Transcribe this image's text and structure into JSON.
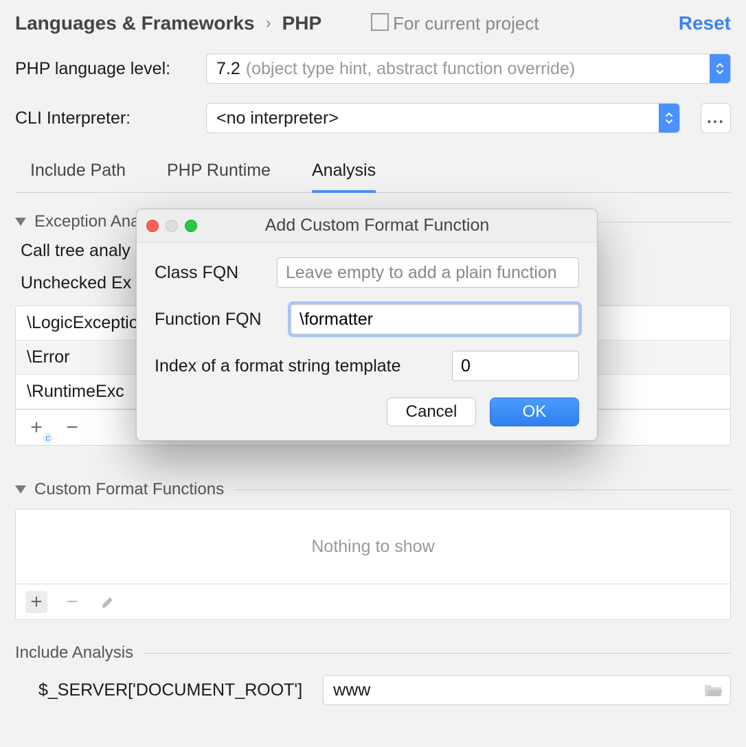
{
  "breadcrumb": {
    "a": "Languages & Frameworks",
    "b": "PHP"
  },
  "scope_label": "For current project",
  "reset_label": "Reset",
  "fields": {
    "lang_level_label": "PHP language level:",
    "lang_level_value": "7.2",
    "lang_level_hint": "(object type hint, abstract function override)",
    "cli_label": "CLI Interpreter:",
    "cli_value": "<no interpreter>",
    "dots": "..."
  },
  "tabs": {
    "t0": "Include Path",
    "t1": "PHP Runtime",
    "t2": "Analysis"
  },
  "exception": {
    "title": "Exception Analysis",
    "call_tree": "Call tree analy",
    "unchecked": "Unchecked Ex",
    "rows": {
      "r0": "\\LogicException",
      "r1": "\\Error",
      "r2": "\\RuntimeExc"
    }
  },
  "cff": {
    "title": "Custom Format Functions",
    "empty": "Nothing to show"
  },
  "include": {
    "title": "Include Analysis",
    "label": "$_SERVER['DOCUMENT_ROOT']",
    "value": "www"
  },
  "dialog": {
    "title": "Add Custom Format Function",
    "class_label": "Class FQN",
    "class_placeholder": "Leave empty to add a plain function",
    "class_value": "",
    "func_label": "Function FQN",
    "func_value": "\\formatter",
    "index_label": "Index of a format string template",
    "index_value": "0",
    "cancel": "Cancel",
    "ok": "OK"
  }
}
